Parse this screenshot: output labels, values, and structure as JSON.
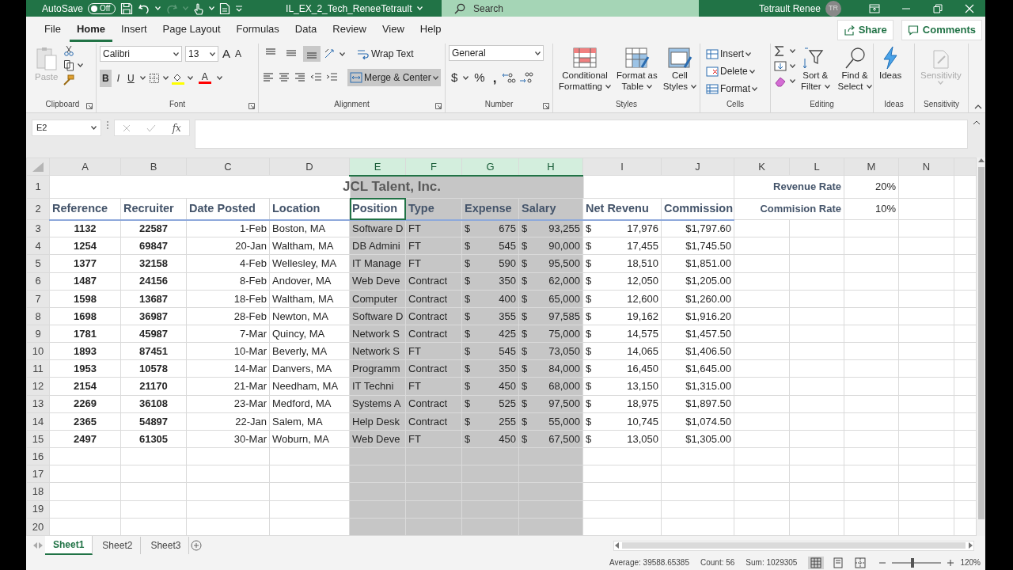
{
  "title_bar": {
    "autosave_label": "AutoSave",
    "autosave": {
      "on": false,
      "label": "Off"
    },
    "file_name": "IL_EX_2_Tech_ReneeTetrault",
    "search_placeholder": "Search",
    "user_name": "Tetrault Renee",
    "user_initials": "TR"
  },
  "ribbon_tabs": [
    {
      "label": "File",
      "selected": false
    },
    {
      "label": "Home",
      "selected": true
    },
    {
      "label": "Insert",
      "selected": false
    },
    {
      "label": "Page Layout",
      "selected": false
    },
    {
      "label": "Formulas",
      "selected": false
    },
    {
      "label": "Data",
      "selected": false
    },
    {
      "label": "Review",
      "selected": false
    },
    {
      "label": "View",
      "selected": false
    },
    {
      "label": "Help",
      "selected": false
    }
  ],
  "share": "Share",
  "comments": "Comments",
  "ribbon": {
    "clipboard": {
      "label": "Clipboard",
      "paste": {
        "label": "Paste",
        "disabled": true
      }
    },
    "font": {
      "label": "Font",
      "family": "Calibri",
      "size": "13",
      "grow": "A",
      "shrink": "A",
      "styles": [
        {
          "kind": "bold",
          "label": "B",
          "selected": true
        },
        {
          "kind": "italic",
          "label": "I",
          "selected": false
        },
        {
          "kind": "underline",
          "label": "U",
          "selected": false
        }
      ],
      "font_color_label": "A"
    },
    "alignment": {
      "label": "Alignment",
      "vertical": [
        {
          "kind": "top",
          "selected": false
        },
        {
          "kind": "middle",
          "selected": false
        },
        {
          "kind": "bottom",
          "selected": true
        }
      ],
      "wrap_text": "Wrap Text",
      "merge": {
        "label": "Merge & Center",
        "selected": true
      }
    },
    "number": {
      "label": "Number",
      "format": "General",
      "currency": "$",
      "percent": "%",
      "comma": ","
    },
    "styles": {
      "label": "Styles",
      "buttons": [
        {
          "kind": "conditional",
          "lines": [
            "Conditional",
            "Formatting"
          ]
        },
        {
          "kind": "table",
          "lines": [
            "Format as",
            "Table"
          ]
        },
        {
          "kind": "cell",
          "lines": [
            "Cell",
            "Styles"
          ]
        }
      ]
    },
    "cells": {
      "label": "Cells",
      "buttons": [
        {
          "kind": "insert",
          "label": "Insert"
        },
        {
          "kind": "delete",
          "label": "Delete"
        },
        {
          "kind": "format",
          "label": "Format"
        }
      ]
    },
    "editing": {
      "label": "Editing",
      "buttons": [
        {
          "kind": "sort",
          "lines": [
            "Sort &",
            "Filter"
          ]
        },
        {
          "kind": "find",
          "lines": [
            "Find &",
            "Select"
          ]
        }
      ]
    },
    "ideas": {
      "label": "Ideas",
      "button": "Ideas"
    },
    "sensitivity": {
      "label": "Sensitivity",
      "button": "Sensitivity",
      "disabled": true
    }
  },
  "formula_bar": {
    "name_box": "E2",
    "fx": "fx"
  },
  "columns": [
    {
      "letter": "A",
      "selected": false
    },
    {
      "letter": "B",
      "selected": false
    },
    {
      "letter": "C",
      "selected": false
    },
    {
      "letter": "D",
      "selected": false
    },
    {
      "letter": "E",
      "selected": true
    },
    {
      "letter": "F",
      "selected": true
    },
    {
      "letter": "G",
      "selected": true
    },
    {
      "letter": "H",
      "selected": true
    },
    {
      "letter": "I",
      "selected": false
    },
    {
      "letter": "J",
      "selected": false
    },
    {
      "letter": "K",
      "selected": false
    },
    {
      "letter": "L",
      "selected": false
    },
    {
      "letter": "M",
      "selected": false
    },
    {
      "letter": "N",
      "selected": false
    }
  ],
  "rows": [
    {
      "num": "1",
      "kind": "title",
      "title": "JCL Talent, Inc.",
      "label": "Revenue Rate",
      "value": "20%"
    },
    {
      "num": "2",
      "kind": "header",
      "headers": [
        {
          "text": "Reference",
          "active": false
        },
        {
          "text": "Recruiter",
          "active": false
        },
        {
          "text": "Date Posted",
          "active": false
        },
        {
          "text": "Location",
          "active": false
        },
        {
          "text": "Position",
          "active": true
        },
        {
          "text": "Type",
          "active": false
        },
        {
          "text": "Expense",
          "active": false
        },
        {
          "text": "Salary",
          "active": false
        },
        {
          "text": "Net Revenu",
          "active": false
        },
        {
          "text": "Commission",
          "active": false
        }
      ],
      "label": "Commision Rate",
      "value": "10%"
    },
    {
      "num": "3",
      "kind": "data",
      "cells": [
        "1132",
        "22587",
        "1-Feb",
        "Boston, MA",
        "Software D",
        "FT",
        {
          "symbol": "$",
          "amount": "675"
        },
        {
          "symbol": "$",
          "amount": "93,255"
        },
        {
          "symbol": "$",
          "amount": "17,976"
        },
        "$1,797.60"
      ]
    },
    {
      "num": "4",
      "kind": "data",
      "cells": [
        "1254",
        "69847",
        "20-Jan",
        "Waltham, MA",
        "DB Admini",
        "FT",
        {
          "symbol": "$",
          "amount": "545"
        },
        {
          "symbol": "$",
          "amount": "90,000"
        },
        {
          "symbol": "$",
          "amount": "17,455"
        },
        "$1,745.50"
      ]
    },
    {
      "num": "5",
      "kind": "data",
      "cells": [
        "1377",
        "32158",
        "4-Feb",
        "Wellesley, MA",
        "IT Manage",
        "FT",
        {
          "symbol": "$",
          "amount": "590"
        },
        {
          "symbol": "$",
          "amount": "95,500"
        },
        {
          "symbol": "$",
          "amount": "18,510"
        },
        "$1,851.00"
      ]
    },
    {
      "num": "6",
      "kind": "data",
      "cells": [
        "1487",
        "24156",
        "8-Feb",
        "Andover, MA",
        "Web Deve",
        "Contract",
        {
          "symbol": "$",
          "amount": "350"
        },
        {
          "symbol": "$",
          "amount": "62,000"
        },
        {
          "symbol": "$",
          "amount": "12,050"
        },
        "$1,205.00"
      ]
    },
    {
      "num": "7",
      "kind": "data",
      "cells": [
        "1598",
        "13687",
        "18-Feb",
        "Waltham, MA",
        "Computer",
        "Contract",
        {
          "symbol": "$",
          "amount": "400"
        },
        {
          "symbol": "$",
          "amount": "65,000"
        },
        {
          "symbol": "$",
          "amount": "12,600"
        },
        "$1,260.00"
      ]
    },
    {
      "num": "8",
      "kind": "data",
      "cells": [
        "1698",
        "36987",
        "28-Feb",
        "Newton, MA",
        "Software D",
        "Contract",
        {
          "symbol": "$",
          "amount": "355"
        },
        {
          "symbol": "$",
          "amount": "97,585"
        },
        {
          "symbol": "$",
          "amount": "19,162"
        },
        "$1,916.20"
      ]
    },
    {
      "num": "9",
      "kind": "data",
      "cells": [
        "1781",
        "45987",
        "7-Mar",
        "Quincy, MA",
        "Network S",
        "Contract",
        {
          "symbol": "$",
          "amount": "425"
        },
        {
          "symbol": "$",
          "amount": "75,000"
        },
        {
          "symbol": "$",
          "amount": "14,575"
        },
        "$1,457.50"
      ]
    },
    {
      "num": "10",
      "kind": "data",
      "cells": [
        "1893",
        "87451",
        "10-Mar",
        "Beverly, MA",
        "Network S",
        "FT",
        {
          "symbol": "$",
          "amount": "545"
        },
        {
          "symbol": "$",
          "amount": "73,050"
        },
        {
          "symbol": "$",
          "amount": "14,065"
        },
        "$1,406.50"
      ]
    },
    {
      "num": "11",
      "kind": "data",
      "cells": [
        "1953",
        "10578",
        "14-Mar",
        "Danvers, MA",
        "Programm",
        "Contract",
        {
          "symbol": "$",
          "amount": "350"
        },
        {
          "symbol": "$",
          "amount": "84,000"
        },
        {
          "symbol": "$",
          "amount": "16,450"
        },
        "$1,645.00"
      ]
    },
    {
      "num": "12",
      "kind": "data",
      "cells": [
        "2154",
        "21170",
        "21-Mar",
        "Needham, MA",
        "IT Techni",
        "FT",
        {
          "symbol": "$",
          "amount": "450"
        },
        {
          "symbol": "$",
          "amount": "68,000"
        },
        {
          "symbol": "$",
          "amount": "13,150"
        },
        "$1,315.00"
      ]
    },
    {
      "num": "13",
      "kind": "data",
      "cells": [
        "2269",
        "36108",
        "23-Mar",
        "Medford, MA",
        "Systems A",
        "Contract",
        {
          "symbol": "$",
          "amount": "525"
        },
        {
          "symbol": "$",
          "amount": "97,500"
        },
        {
          "symbol": "$",
          "amount": "18,975"
        },
        "$1,897.50"
      ]
    },
    {
      "num": "14",
      "kind": "data",
      "cells": [
        "2365",
        "54897",
        "22-Jan",
        "Salem, MA",
        "Help Desk",
        "Contract",
        {
          "symbol": "$",
          "amount": "255"
        },
        {
          "symbol": "$",
          "amount": "55,000"
        },
        {
          "symbol": "$",
          "amount": "10,745"
        },
        "$1,074.50"
      ]
    },
    {
      "num": "15",
      "kind": "data",
      "cells": [
        "2497",
        "61305",
        "30-Mar",
        "Woburn, MA",
        "Web Deve",
        "FT",
        {
          "symbol": "$",
          "amount": "450"
        },
        {
          "symbol": "$",
          "amount": "67,500"
        },
        {
          "symbol": "$",
          "amount": "13,050"
        },
        "$1,305.00"
      ]
    },
    {
      "num": "16",
      "kind": "empty"
    },
    {
      "num": "17",
      "kind": "empty"
    },
    {
      "num": "18",
      "kind": "empty"
    },
    {
      "num": "19",
      "kind": "empty"
    },
    {
      "num": "20",
      "kind": "empty"
    }
  ],
  "sheet_tabs": [
    {
      "label": "Sheet1",
      "selected": true
    },
    {
      "label": "Sheet2",
      "selected": false
    },
    {
      "label": "Sheet3",
      "selected": false
    }
  ],
  "status_bar": {
    "stats": [
      "Average: 39588.65385",
      "Count: 56",
      "Sum: 1029305"
    ],
    "views": [
      {
        "kind": "normal",
        "selected": true
      },
      {
        "kind": "page_layout",
        "selected": false
      },
      {
        "kind": "page_break",
        "selected": false
      }
    ],
    "zoom": {
      "level": 0.42,
      "label": "120%"
    }
  }
}
